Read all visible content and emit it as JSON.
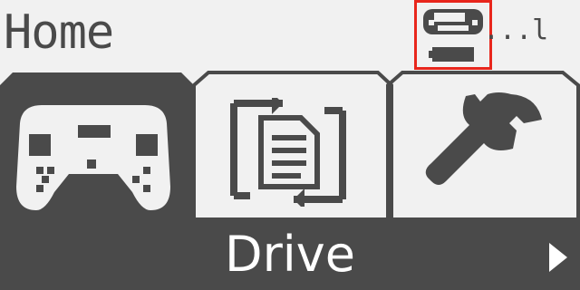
{
  "header": {
    "title": "Home",
    "signal_text": "...l"
  },
  "menu": {
    "selected_label": "Drive",
    "items": [
      {
        "id": "drive",
        "icon": "controller-icon"
      },
      {
        "id": "transfer",
        "icon": "transfer-document-icon"
      },
      {
        "id": "settings",
        "icon": "wrench-icon"
      }
    ],
    "selected_index": 0
  },
  "colors": {
    "background": "#f1f1f1",
    "dark": "#4a4a4a",
    "highlight": "#e8261c",
    "text_light": "#ffffff"
  }
}
